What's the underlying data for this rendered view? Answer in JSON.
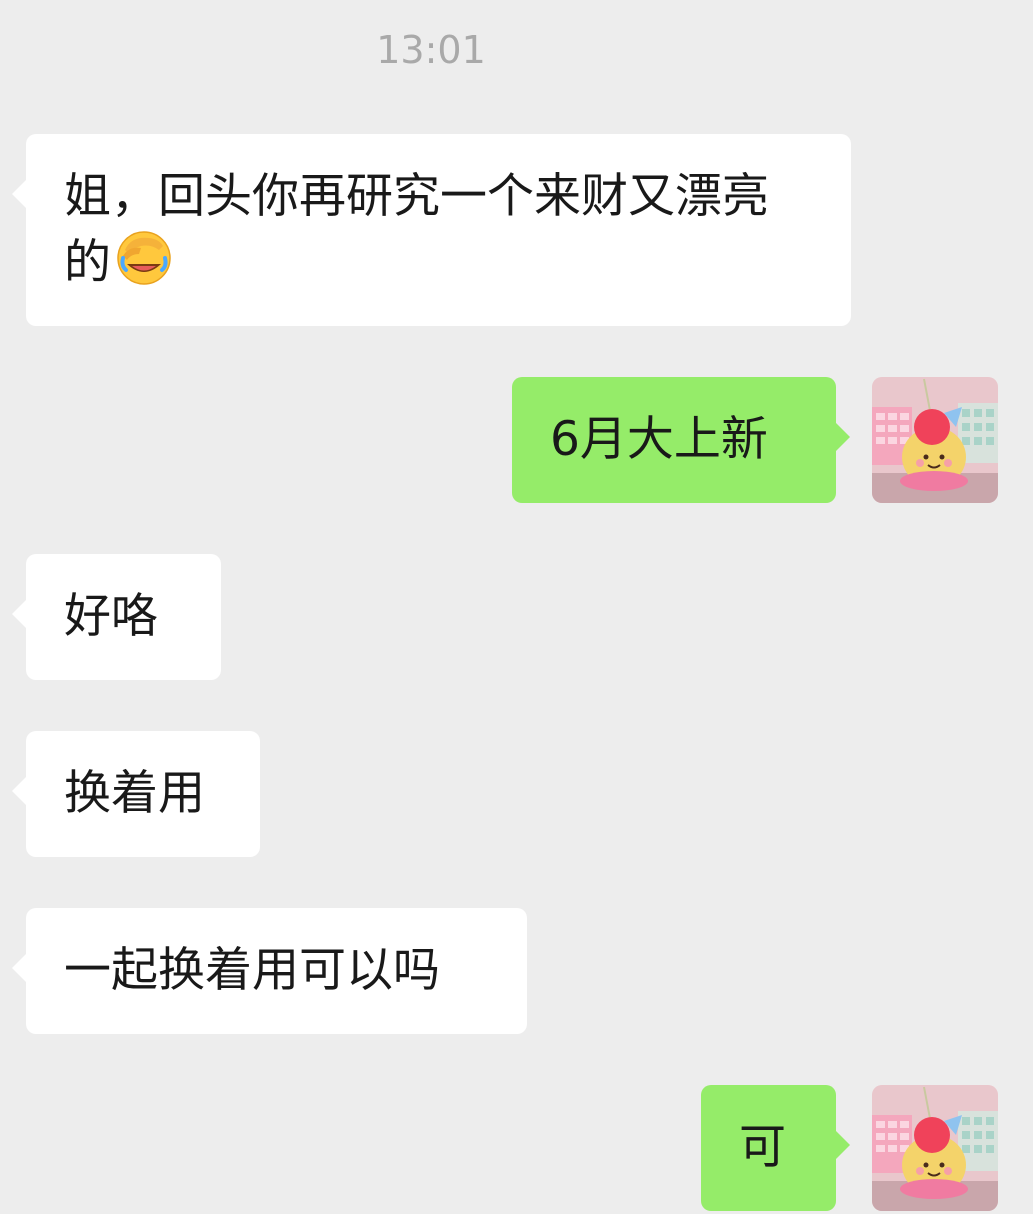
{
  "timestamp": "13:01",
  "messages": [
    {
      "side": "received",
      "text": "姐，回头你再研究一个来财又漂亮的",
      "emoji": "face-palm-laughing-emoji"
    },
    {
      "side": "sent",
      "text": "6月大上新",
      "avatar": "plush-toy-avatar"
    },
    {
      "side": "received",
      "text": "好咯"
    },
    {
      "side": "received",
      "text": "换着用"
    },
    {
      "side": "received",
      "text": "一起换着用可以吗"
    },
    {
      "side": "sent",
      "text": "可",
      "avatar": "plush-toy-avatar"
    }
  ],
  "colors": {
    "background": "#ededed",
    "received_bubble": "#ffffff",
    "sent_bubble": "#95ec69",
    "timestamp_text": "#a9a9a9"
  }
}
